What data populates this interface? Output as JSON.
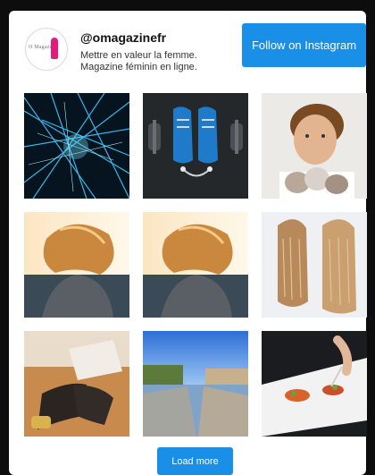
{
  "profile": {
    "username": "@omagazinefr",
    "bio_lines": [
      "Mettre en valeur la femme.",
      "Magazine féminin en ligne."
    ],
    "avatar_text": "O Magazine"
  },
  "follow_button": {
    "label": "Follow on Instagram"
  },
  "load_more_button": {
    "label": "Load more"
  },
  "colors": {
    "button": "#1a8fe8",
    "brand_pink": "#e6197d",
    "background": "#0d0d0d"
  },
  "photos": [
    {
      "name": "photo-network-lights"
    },
    {
      "name": "photo-sneakers-dumbbells"
    },
    {
      "name": "photo-man-with-kittens"
    },
    {
      "name": "photo-woman-hair-sunset"
    },
    {
      "name": "photo-woman-hair-sunset-duplicate"
    },
    {
      "name": "photo-long-hair-back"
    },
    {
      "name": "photo-legs-tights"
    },
    {
      "name": "photo-city-canal"
    },
    {
      "name": "photo-plated-dish"
    }
  ]
}
